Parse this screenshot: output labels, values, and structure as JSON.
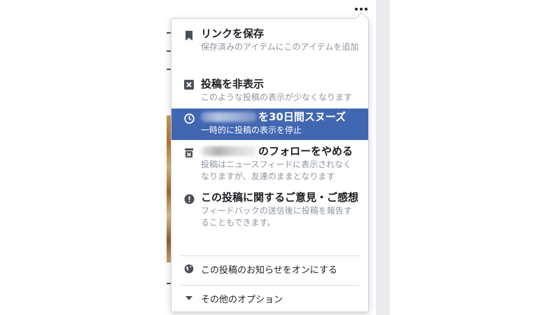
{
  "menu": {
    "save_link": {
      "title": "リンクを保存",
      "desc": "保存済みのアイテムにこのアイテムを追加"
    },
    "hide_post": {
      "title": "投稿を非表示",
      "desc": "このような投稿の表示が少なくなります"
    },
    "snooze": {
      "title_suffix": "を30日間スヌーズ",
      "desc": "一時的に投稿の表示を停止"
    },
    "unfollow": {
      "title_suffix": "のフォローをやめる",
      "desc": "投稿はニュースフィードに表示されなくなりますが、友達のままとなります"
    },
    "feedback": {
      "title": "この投稿に関するご意見・ご感想",
      "desc": "フィードバックの送信後に投稿を報告することもできます。"
    },
    "notifications": {
      "label": "この投稿のお知らせをオンにする"
    },
    "more_options": {
      "label": "その他のオプション"
    }
  },
  "colors": {
    "highlight": "#4267b2",
    "text": "#1c1e21",
    "subtext": "#8d949e"
  },
  "icons": {
    "save_link": "bookmark-icon",
    "hide_post": "close-box-icon",
    "snooze": "clock-icon",
    "unfollow": "unfollow-icon",
    "feedback": "alert-icon",
    "notifications": "globe-icon",
    "more_options": "caret-down-icon",
    "more": "more-dots-icon"
  }
}
